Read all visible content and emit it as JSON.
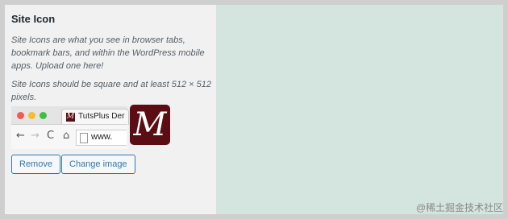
{
  "section": {
    "title": "Site Icon",
    "description": "Site Icons are what you see in browser tabs, bookmark bars, and within the WordPress mobile apps. Upload one here!",
    "requirement": "Site Icons should be square and at least 512 × 512 pixels."
  },
  "preview": {
    "tab_title": "TutsPlus Der",
    "tab_favicon": "M",
    "url_text": "www.",
    "back_icon": "←",
    "forward_icon": "→",
    "reload_icon": "C",
    "home_icon": "⌂",
    "app_icon_letter": "M"
  },
  "buttons": {
    "remove": "Remove",
    "change_image": "Change image"
  },
  "watermark": "@稀土掘金技术社区",
  "colors": {
    "accent": "#2f78b4",
    "icon_bg": "#5b0d13",
    "right_panel_bg": "#d4e5e0"
  }
}
